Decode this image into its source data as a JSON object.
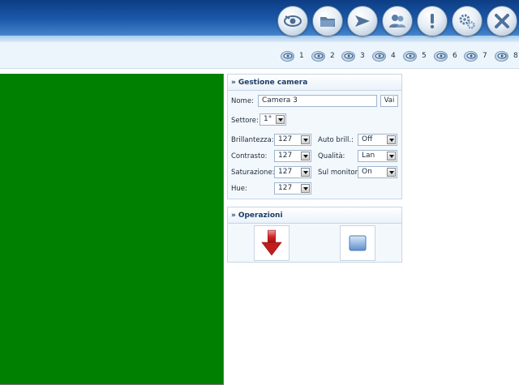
{
  "toolbar": {
    "buttons": [
      {
        "icon": "eye-icon"
      },
      {
        "icon": "folder-icon"
      },
      {
        "icon": "send-icon"
      },
      {
        "icon": "users-icon"
      },
      {
        "icon": "alert-icon"
      },
      {
        "icon": "settings-icon"
      },
      {
        "icon": "close-icon"
      }
    ]
  },
  "cameras": [
    "1",
    "2",
    "3",
    "4",
    "5",
    "6",
    "7",
    "8"
  ],
  "video": {
    "color": "#008000"
  },
  "gestione": {
    "title": "Gestione camera",
    "nome_label": "Nome:",
    "nome_value": "Camera 3",
    "vai_label": "Vai",
    "settore_label": "Settore:",
    "settore_value": "1°",
    "brillantezza_label": "Brillantezza:",
    "brillantezza_value": "127",
    "contrasto_label": "Contrasto:",
    "contrasto_value": "127",
    "saturazione_label": "Saturazione:",
    "saturazione_value": "127",
    "hue_label": "Hue:",
    "hue_value": "127",
    "autobrill_label": "Auto brill.:",
    "autobrill_value": "Off",
    "qualita_label": "Qualità:",
    "qualita_value": "Lan",
    "sulmonitor_label": "Sul monitor:",
    "sulmonitor_value": "On"
  },
  "operazioni": {
    "title": "Operazioni",
    "buttons": [
      {
        "icon": "download-arrow-icon"
      },
      {
        "icon": "window-icon"
      }
    ]
  }
}
